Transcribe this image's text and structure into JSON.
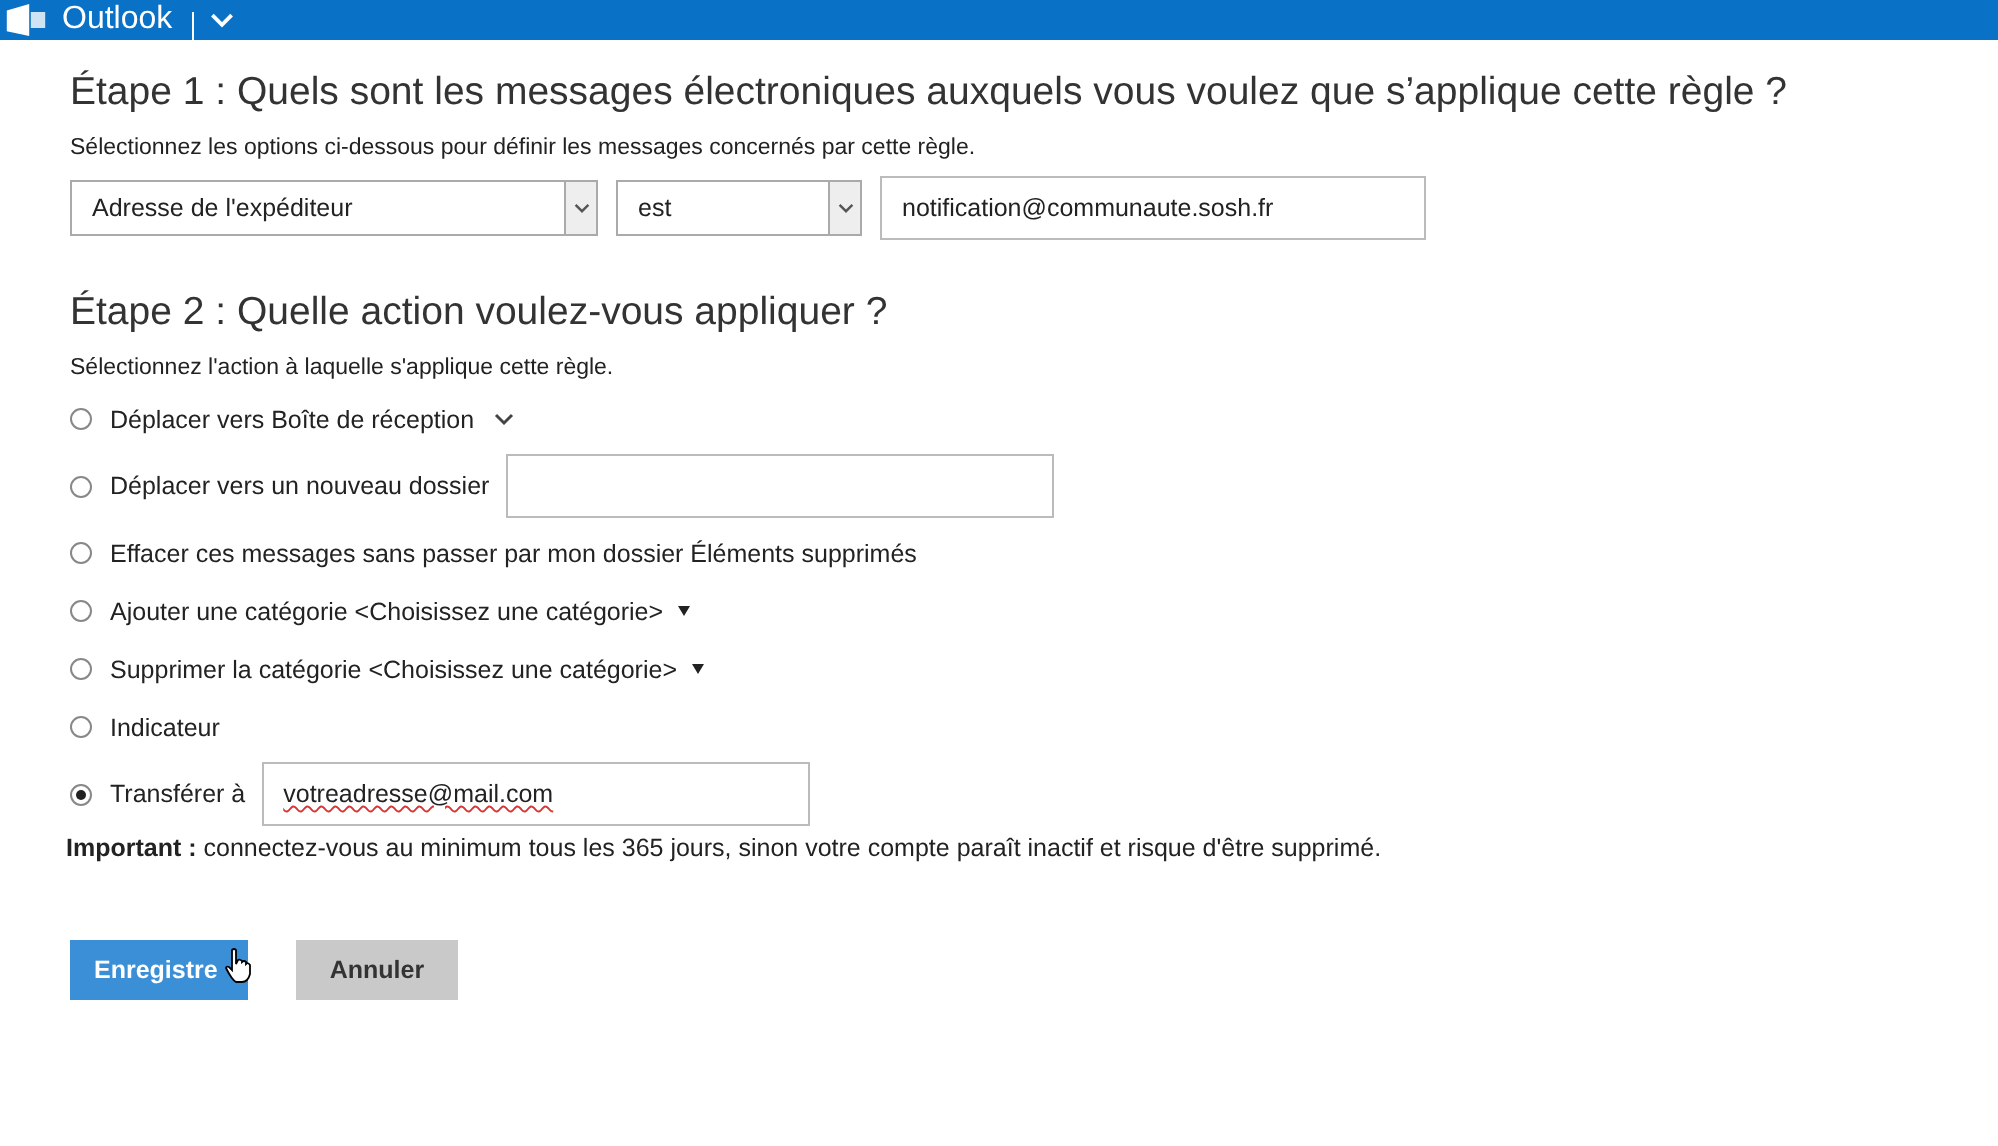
{
  "header": {
    "app_name": "Outlook"
  },
  "step1": {
    "title": "Étape 1 : Quels sont les messages électroniques auxquels vous voulez que s’applique cette règle ?",
    "hint": "Sélectionnez les options ci-dessous pour définir les messages concernés par cette règle.",
    "condition": {
      "field": "Adresse de l'expéditeur",
      "operator": "est",
      "value": "notification@communaute.sosh.fr"
    }
  },
  "step2": {
    "title": "Étape 2 : Quelle action voulez-vous appliquer ?",
    "hint": "Sélectionnez l'action à laquelle s'applique cette règle.",
    "actions": [
      {
        "kind": "dropdown",
        "label": "Déplacer vers Boîte de réception",
        "selected": false
      },
      {
        "kind": "input",
        "label": "Déplacer vers un nouveau dossier",
        "selected": false
      },
      {
        "kind": "plain",
        "label": "Effacer ces messages sans passer par mon dossier Éléments supprimés",
        "selected": false
      },
      {
        "kind": "menu",
        "label": "Ajouter une catégorie <Choisissez une catégorie>",
        "selected": false
      },
      {
        "kind": "menu",
        "label": "Supprimer la catégorie <Choisissez une catégorie>",
        "selected": false
      },
      {
        "kind": "plain",
        "label": "Indicateur",
        "selected": false
      },
      {
        "kind": "input",
        "label": "Transférer à",
        "value": "votreadresse@mail.com",
        "selected": true
      }
    ]
  },
  "notice": "**Important :** connectez-vous au minimum tous les 365 jours, sinon votre compte paraît inactif et risque d'être supprimé.",
  "buttons": [
    {
      "kind": "primary",
      "label": "Enregistre"
    },
    {
      "kind": "secondary",
      "label": "Annuler"
    }
  ]
}
